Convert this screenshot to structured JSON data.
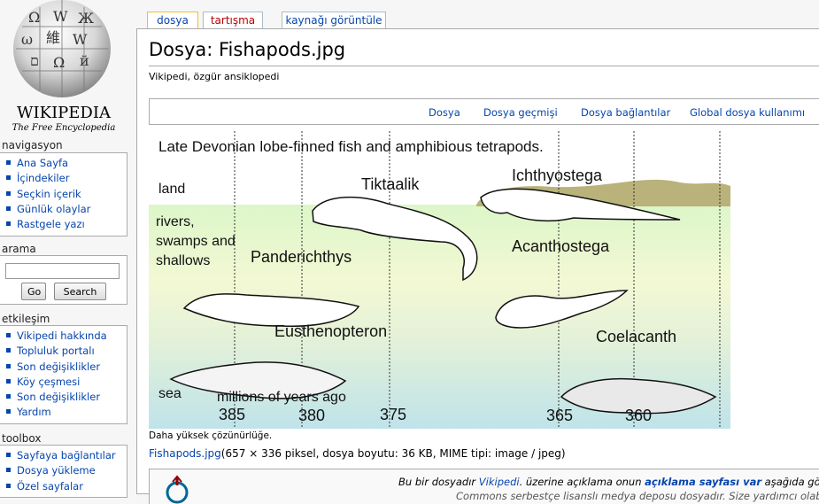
{
  "logo": {
    "wordmark": "WIKIPEDIA",
    "tagline": "The Free Encyclopedia"
  },
  "tabs": [
    {
      "label": "dosya"
    },
    {
      "label": "tartışma"
    },
    {
      "label": "kaynağı görüntüle"
    }
  ],
  "sidebar": {
    "navigation": {
      "heading": "navigasyon",
      "items": [
        "Ana Sayfa",
        "İçindekiler",
        "Seçkin içerik",
        "Günlük olaylar",
        "Rastgele yazı"
      ]
    },
    "search": {
      "heading": "arama",
      "placeholder": "",
      "go_label": "Go",
      "search_label": "Search"
    },
    "interaction": {
      "heading": "etkileşim",
      "items": [
        "Vikipedi hakkında",
        "Topluluk portalı",
        "Son değişiklikler",
        "Köy çeşmesi",
        "Son değişiklikler",
        "Yardım"
      ]
    },
    "toolbox": {
      "heading": "toolbox",
      "items": [
        "Sayfaya bağlantılar",
        "Dosya yükleme",
        "Özel sayfalar"
      ]
    }
  },
  "content": {
    "title": "Dosya: Fishapods.jpg",
    "subtitle": "Vikipedi, özgür ansiklopedi",
    "file_menu": [
      "Dosya",
      "Dosya geçmişi",
      "Dosya bağlantılar",
      "Global dosya kullanımı"
    ],
    "figure": {
      "heading": "Late Devonian lobe-finned fish and amphibious tetrapods.",
      "zones": {
        "land": "land",
        "rivers_1": "rivers,",
        "rivers_2": "swamps and",
        "rivers_3": "shallows",
        "sea": "sea"
      },
      "species": [
        "Tiktaalik",
        "Ichthyostega",
        "Acanthostega",
        "Panderichthys",
        "Eusthenopteron",
        "Coelacanth"
      ],
      "axis_label": "millions of years ago",
      "ticks": [
        "385",
        "380",
        "375",
        "365",
        "360"
      ]
    },
    "hires_text": "Daha yüksek çözünürlüğe.",
    "file_link": "Fishapods.jpg",
    "file_details": "(657 × 336 piksel, dosya boyutu: 36 KB, MIME tipi: image / jpeg)",
    "description": {
      "prefix": "Bu bir dosyadır ",
      "link1": "Vikipedi",
      "middle": ". üzerine açıklama onun ",
      "link2": "açıklama sayfası var",
      "suffix": " aşağıda gös",
      "line2": "Commons serbestçe lisanslı medya deposu dosyadır. Size yardımcı olab"
    }
  },
  "colors": {
    "link": "#0645ad",
    "new_link": "#ba0000",
    "land": "#b9b27a",
    "shallow_green": "#d9f3c2",
    "sea_blue": "#c4e6ec"
  }
}
